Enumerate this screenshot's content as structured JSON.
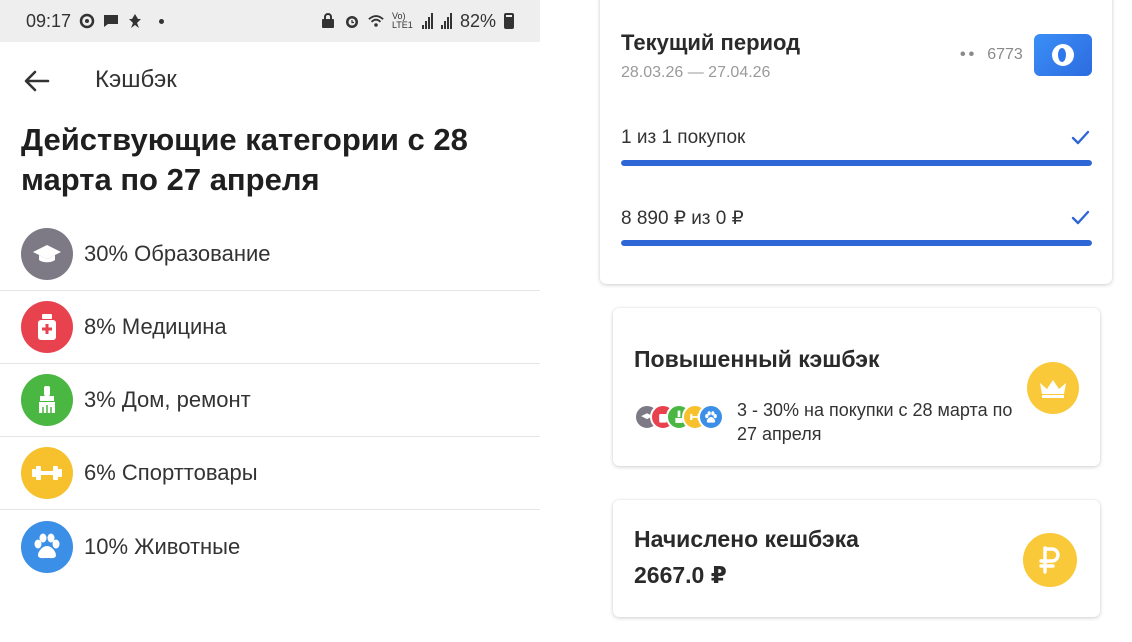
{
  "status_bar": {
    "time": "09:17",
    "battery": "82%",
    "network_label": "Vo) LTE1"
  },
  "app_bar": {
    "title": "Кэшбэк"
  },
  "heading": "Действующие категории с 28 марта по 27 апреля",
  "categories": [
    {
      "label": "30% Образование",
      "icon": "graduation-cap-icon",
      "color": "#7d7a86"
    },
    {
      "label": "8% Медицина",
      "icon": "medicine-bottle-icon",
      "color": "#e8424f"
    },
    {
      "label": "3% Дом, ремонт",
      "icon": "paint-brush-icon",
      "color": "#4bb743"
    },
    {
      "label": "6% Спорттовары",
      "icon": "dumbbell-icon",
      "color": "#f7c12d"
    },
    {
      "label": "10% Животные",
      "icon": "paw-icon",
      "color": "#3c8fe6"
    }
  ],
  "current_period": {
    "title": "Текущий период",
    "dates": "28.03.26 — 27.04.26",
    "card_mask": "••",
    "card_last4": "6773",
    "progress": [
      {
        "label": "1 из  1 покупок",
        "fill": 1.0,
        "done": true
      },
      {
        "label": "8 890 ₽ из 0 ₽",
        "fill": 1.0,
        "done": true
      }
    ]
  },
  "boosted": {
    "title": "Повышенный кэшбэк",
    "description": "3 - 30% на покупки с 28 марта по 27 апреля"
  },
  "accrued": {
    "title": "Начислено кешбэка",
    "amount": "2667.0 ₽"
  },
  "colors": {
    "accent_blue": "#2f66d6",
    "badge_yellow": "#f9c93a"
  }
}
